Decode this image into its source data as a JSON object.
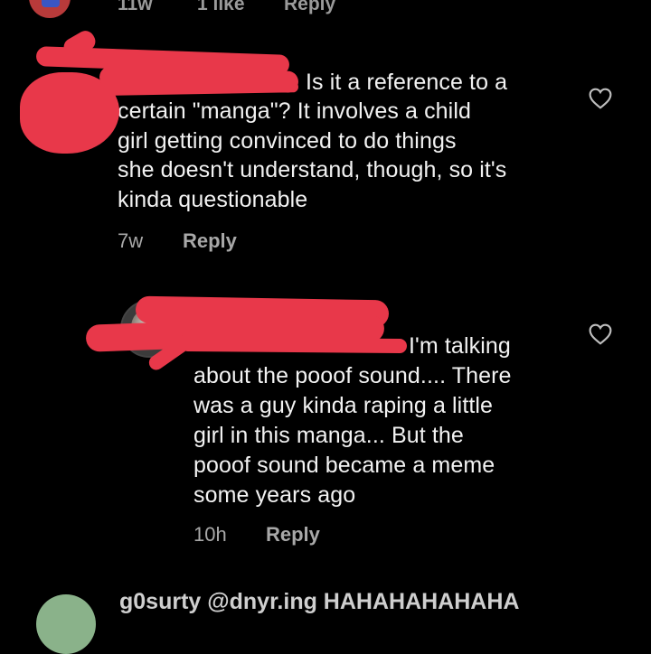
{
  "top_comment": {
    "time": "11w",
    "likes": "1 like",
    "reply_label": "Reply"
  },
  "comment1": {
    "text_lines": [
      "Is it a reference to a",
      "certain \"manga\"? It involves a child",
      "girl getting convinced to do things",
      "she doesn't understand, though, so it's",
      "kinda questionable"
    ],
    "time": "7w",
    "reply_label": "Reply",
    "like_icon": "heart-outline-icon"
  },
  "comment2": {
    "text_lines": [
      "I'm talking",
      "about the pooof sound.... There",
      "was a guy kinda raping a little",
      "girl in this manga... But the",
      "pooof sound became a meme",
      "some years ago"
    ],
    "time": "10h",
    "reply_label": "Reply",
    "like_icon": "heart-outline-icon"
  },
  "bottom_comment": {
    "text": "g0surty @dnyr.ing HAHAHAHAHAHA"
  },
  "colors": {
    "background": "#000000",
    "text": "#f2f2f2",
    "meta": "#a8a8a8",
    "redaction": "#e8384a"
  }
}
